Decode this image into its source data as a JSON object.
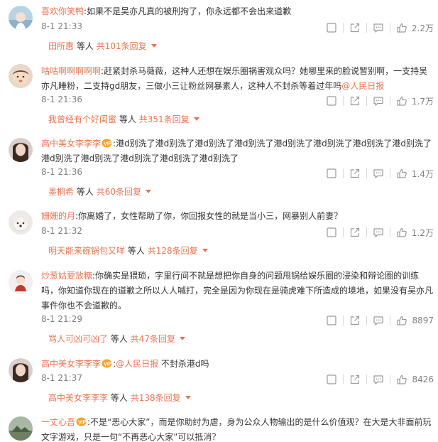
{
  "colors": {
    "username": "#eb7350",
    "text": "#333333",
    "meta": "#808080"
  },
  "icons": {
    "hide": "square-icon",
    "share": "share-icon",
    "comment": "comment-icon",
    "like": "thumbs-up-icon",
    "vip": "vip-badge-icon"
  },
  "comments": [
    {
      "user": "喜欢你笑鸭",
      "text": "如果不是吴亦凡真的被刑拘了，你永远都不会出来道歉",
      "date": "8-1 21:33",
      "likes": "2.2万",
      "reply": {
        "user": "田所惠",
        "middle": "等人",
        "total": "共101条回复"
      }
    },
    {
      "user": "咕咕啊啊啊啊啊",
      "text": "赶紧封杀马薇薇，这种人还想在娱乐圈祸害观众吗？她哪里来的脸说暂别啊，一支持吴亦凡睡粉，二支持gd朋友，三做小三让粉丝网暴素人，这种人不封杀等着过年吗",
      "at": "@人民日报",
      "date": "8-1 21:36",
      "likes": "1.7万",
      "reply": {
        "user": "我曾经有个好闺蜜",
        "middle": "等人",
        "total": "共351条回复"
      }
    },
    {
      "user": "高中美女李李李",
      "text": "港d别洗了港d别洗了港d别洗了港d别洗了港d别洗了港d别洗了港d别洗了港d别洗了港d别洗了港d别洗了港d别洗了港d别洗了港d别洗了",
      "date": "8-1 21:36",
      "likes": "1.4万",
      "reply": {
        "user": "墨桐希",
        "middle": "等人",
        "total": "共60条回复"
      }
    },
    {
      "user": "姗姗的月",
      "text": "你离婚了，女性帮助了你，你回报女性的就是当小三，网暴别人前妻？",
      "date": "8-1 21:32",
      "likes": "1.2万",
      "reply": {
        "user": "明天能来碗锅包又咩",
        "middle": "等人",
        "total": "共128条回复"
      }
    },
    {
      "user": "炒葱姑要放糖",
      "text": "你确实是猥琐，字里行间不就是想把你自身的问题甩锅给娱乐圈的浸染和辩论圈的训练吗，你知道你现在的道歉之所以人人喊打，完全是因为你现在是骑虎难下所造成的境地，如果没有吴亦凡事件你也不会道歉的。",
      "date": "8-1 21:29",
      "likes": "8897",
      "reply": {
        "user": "骂人可凶可凶了",
        "middle": "等人",
        "total": "共47条回复"
      }
    },
    {
      "user": "高中美女李李李",
      "at": "@人民日报",
      "text": "不封杀港d吗",
      "date": "8-1 21:37",
      "likes": "8426",
      "reply": {
        "user": "高中美女李李李",
        "middle": "等人",
        "total": "共138条回复"
      }
    },
    {
      "user": "一丈心吾",
      "text": "不是“恶心大家”，而是你助纣为虐，身为公众人物输出的是什么价值观？在大是大非面前玩文字游戏，只是一句“不再恶心大家”可以抵消？"
    }
  ]
}
